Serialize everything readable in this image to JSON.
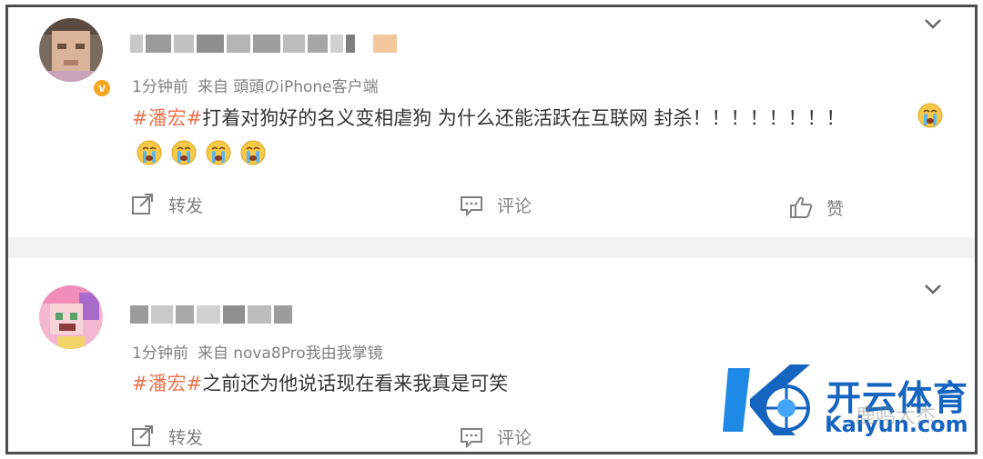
{
  "posts": [
    {
      "meta_time": "1分钟前",
      "meta_from": "来自 頭頭のiPhone客户端",
      "topic": "#潘宏#",
      "body": "打着对狗好的名义变相虐狗 为什么还能活跃在互联网 封杀！！！！！！！！",
      "emoji": "crying-face-icon",
      "actions": {
        "repost": "转发",
        "comment": "评论",
        "like": "赞"
      }
    },
    {
      "meta_time": "1分钟前",
      "meta_from": "来自 nova8Pro我由我掌镜",
      "topic": "#潘宏#",
      "body": "之前还为他说话现在看来我真是可笑",
      "actions": {
        "repost": "转发",
        "comment": "评论"
      }
    }
  ],
  "watermark": {
    "brand": "开云体育",
    "site": "Kaiyun.com",
    "faint": "鹿鸣大杰"
  },
  "colors": {
    "topic": "#eb7350",
    "meta": "#808080",
    "verified_badge": "#f5a623",
    "watermark": "#1565c0"
  }
}
